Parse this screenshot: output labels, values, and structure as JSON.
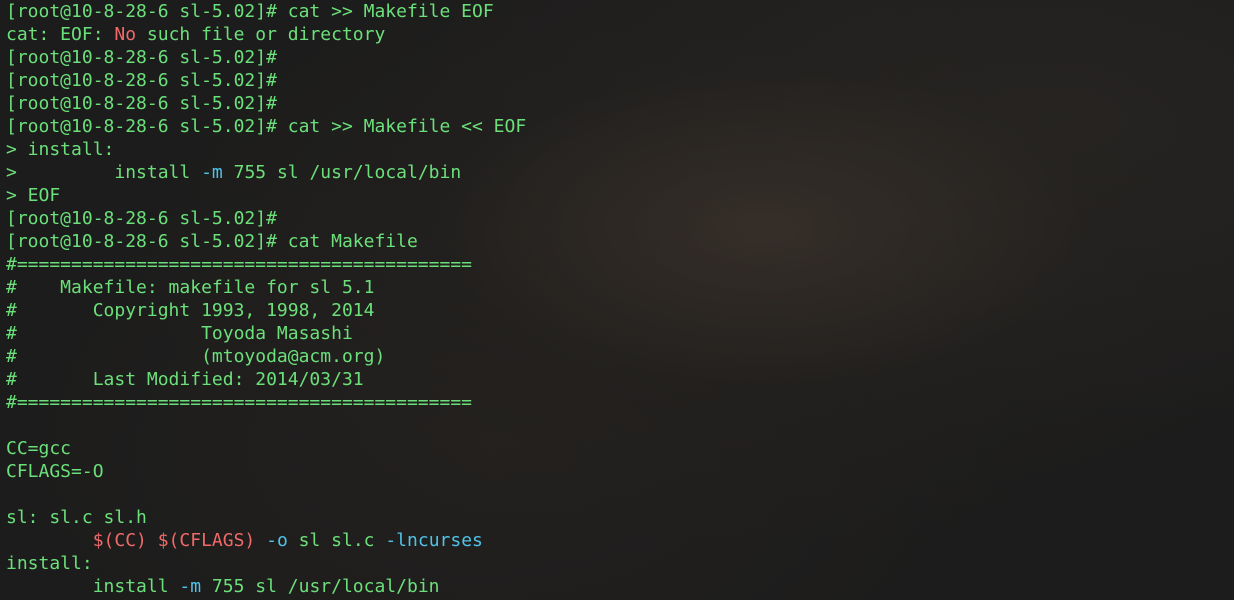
{
  "colors": {
    "text": "#6be07a",
    "error": "#f06a6a",
    "option": "#4fc3e8",
    "background": "#1c1c1c"
  },
  "terminal": {
    "lines": [
      [
        {
          "t": "[root@10-8-28-6 sl-5.02]# cat >> Makefile EOF",
          "c": "g"
        }
      ],
      [
        {
          "t": "cat: EOF: ",
          "c": "g"
        },
        {
          "t": "No",
          "c": "r"
        },
        {
          "t": " such file or directory",
          "c": "g"
        }
      ],
      [
        {
          "t": "[root@10-8-28-6 sl-5.02]#",
          "c": "g"
        }
      ],
      [
        {
          "t": "[root@10-8-28-6 sl-5.02]#",
          "c": "g"
        }
      ],
      [
        {
          "t": "[root@10-8-28-6 sl-5.02]#",
          "c": "g"
        }
      ],
      [
        {
          "t": "[root@10-8-28-6 sl-5.02]# cat >> Makefile << EOF",
          "c": "g"
        }
      ],
      [
        {
          "t": "> install:",
          "c": "g"
        }
      ],
      [
        {
          "t": ">         install ",
          "c": "g"
        },
        {
          "t": "-m",
          "c": "c"
        },
        {
          "t": " 755 sl /usr/local/bin",
          "c": "g"
        }
      ],
      [
        {
          "t": "> EOF",
          "c": "g"
        }
      ],
      [
        {
          "t": "[root@10-8-28-6 sl-5.02]#",
          "c": "g"
        }
      ],
      [
        {
          "t": "[root@10-8-28-6 sl-5.02]# cat Makefile",
          "c": "g"
        }
      ],
      [
        {
          "t": "#==========================================",
          "c": "g"
        }
      ],
      [
        {
          "t": "#    Makefile: makefile for sl 5.1",
          "c": "g"
        }
      ],
      [
        {
          "t": "#       Copyright 1993, 1998, 2014",
          "c": "g"
        }
      ],
      [
        {
          "t": "#                 Toyoda Masashi",
          "c": "g"
        }
      ],
      [
        {
          "t": "#                 (mtoyoda@acm.org)",
          "c": "g"
        }
      ],
      [
        {
          "t": "#       Last Modified: 2014/03/31",
          "c": "g"
        }
      ],
      [
        {
          "t": "#==========================================",
          "c": "g"
        }
      ],
      [
        {
          "t": "",
          "c": "g"
        }
      ],
      [
        {
          "t": "CC=gcc",
          "c": "g"
        }
      ],
      [
        {
          "t": "CFLAGS=-O",
          "c": "g"
        }
      ],
      [
        {
          "t": "",
          "c": "g"
        }
      ],
      [
        {
          "t": "sl: sl.c sl.h",
          "c": "g"
        }
      ],
      [
        {
          "t": "        ",
          "c": "g"
        },
        {
          "t": "$(CC) $(CFLAGS)",
          "c": "r"
        },
        {
          "t": " ",
          "c": "g"
        },
        {
          "t": "-o",
          "c": "c"
        },
        {
          "t": " sl sl.c ",
          "c": "g"
        },
        {
          "t": "-lncurses",
          "c": "c"
        }
      ],
      [
        {
          "t": "install:",
          "c": "g"
        }
      ],
      [
        {
          "t": "        install ",
          "c": "g"
        },
        {
          "t": "-m",
          "c": "c"
        },
        {
          "t": " 755 sl /usr/local/bin",
          "c": "g"
        }
      ]
    ]
  }
}
